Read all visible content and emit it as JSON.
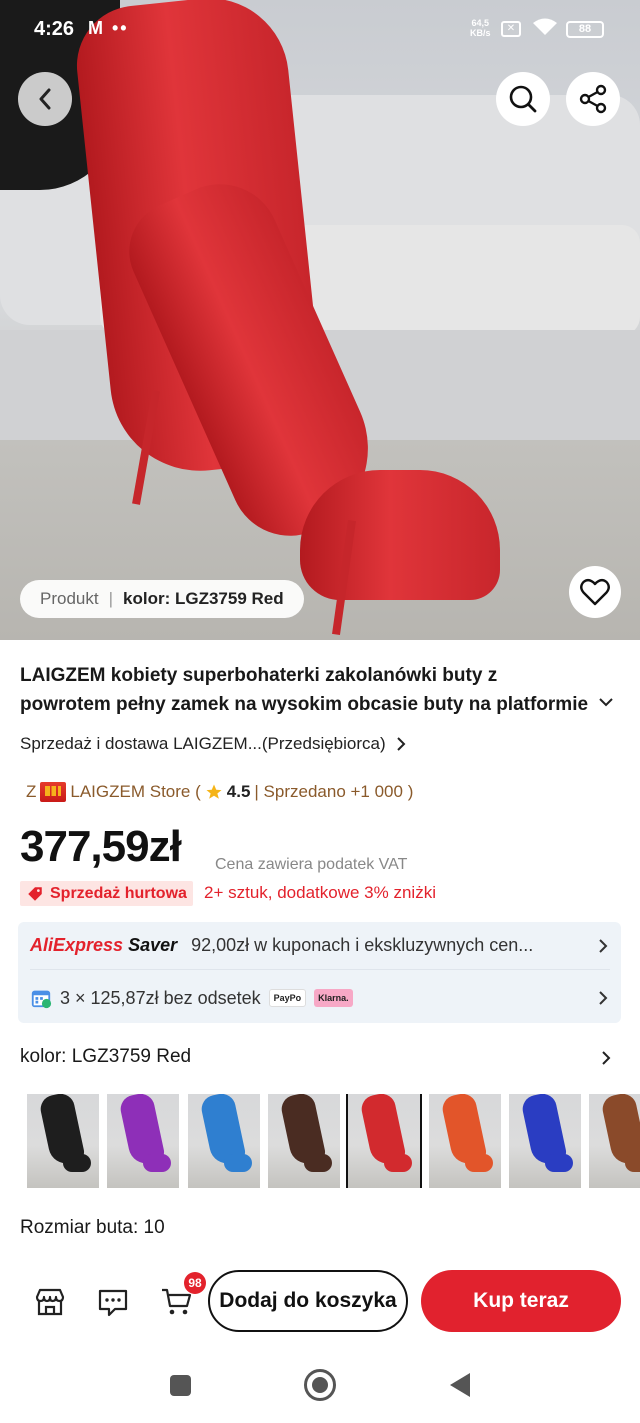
{
  "status_bar": {
    "time": "4:26",
    "indicators": "M ••",
    "net_speed_top": "64,5",
    "net_speed_bottom": "KB/s",
    "battery": "88"
  },
  "hero": {
    "variant_prefix": "Produkt",
    "variant_value": "kolor: LGZ3759 Red"
  },
  "product": {
    "title_line1": "LAIGZEM kobiety superbohaterki zakolanówki buty z",
    "title_line2": "powrotem pełny zamek na wysokim obcasie buty na platformie",
    "seller": "Sprzedaż i dostawa LAIGZEM...(Przedsiębiorca)",
    "store_prefix": "Z",
    "store_name": "LAIGZEM Store (",
    "store_rating": "4.5",
    "store_sold": "| Sprzedano +1 000 )",
    "price": "377,59zł",
    "vat_note": "Cena zawiera podatek VAT",
    "wholesale_label": "Sprzedaż hurtowa",
    "wholesale_text": "2+ sztuk, dodatkowe 3% zniżki"
  },
  "promo": {
    "brand_ali": "AliExpress",
    "brand_saver": "Saver",
    "coupon_text": "92,00zł w kuponach i ekskluzywnych cen...",
    "installments_text": "3 × 125,87zł bez odsetek",
    "paypo": "PayPo",
    "klarna": "Klarna."
  },
  "variants": {
    "color_label": "kolor: LGZ3759 Red",
    "swatches": [
      {
        "color": "#1e1e1e"
      },
      {
        "color": "#8e2fb8"
      },
      {
        "color": "#2f7fd0"
      },
      {
        "color": "#4a2c22"
      },
      {
        "color": "#d22a2e",
        "selected": true
      },
      {
        "color": "#e2552a"
      },
      {
        "color": "#2a3dc2"
      },
      {
        "color": "#8a4a2a"
      }
    ],
    "size_label": "Rozmiar buta: 10"
  },
  "actions": {
    "cart_count": "98",
    "add_to_cart": "Dodaj do koszyka",
    "buy_now": "Kup teraz"
  },
  "colors": {
    "accent": "#e1222e",
    "store_text": "#8a5a2b"
  }
}
